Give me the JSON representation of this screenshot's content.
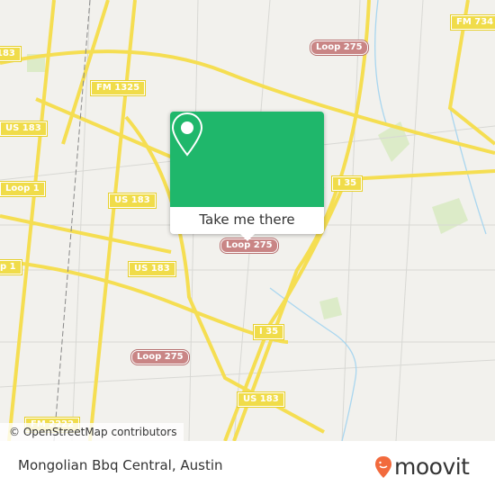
{
  "map": {
    "shields": [
      {
        "label": "FM 734",
        "type": "highway"
      },
      {
        "label": "Loop 275",
        "type": "loop"
      },
      {
        "label": "183",
        "type": "highway"
      },
      {
        "label": "FM 1325",
        "type": "highway"
      },
      {
        "label": "US 183",
        "type": "highway"
      },
      {
        "label": "Loop 1",
        "type": "highway"
      },
      {
        "label": "US 183",
        "type": "highway"
      },
      {
        "label": "I 35",
        "type": "highway"
      },
      {
        "label": "Loop 275",
        "type": "loop"
      },
      {
        "label": "p 1",
        "type": "highway"
      },
      {
        "label": "US 183",
        "type": "highway"
      },
      {
        "label": "I 35",
        "type": "highway"
      },
      {
        "label": "Loop 275",
        "type": "loop"
      },
      {
        "label": "US 183",
        "type": "highway"
      },
      {
        "label": "FM 2222",
        "type": "highway"
      }
    ],
    "attribution": "© OpenStreetMap contributors"
  },
  "popup": {
    "icon": "map-pin-icon",
    "cta": "Take me there",
    "color": "#1fb76b"
  },
  "footer": {
    "place": "Mongolian Bbq Central, Austin",
    "brand": "moovit",
    "brand_color": "#f26a3d"
  }
}
